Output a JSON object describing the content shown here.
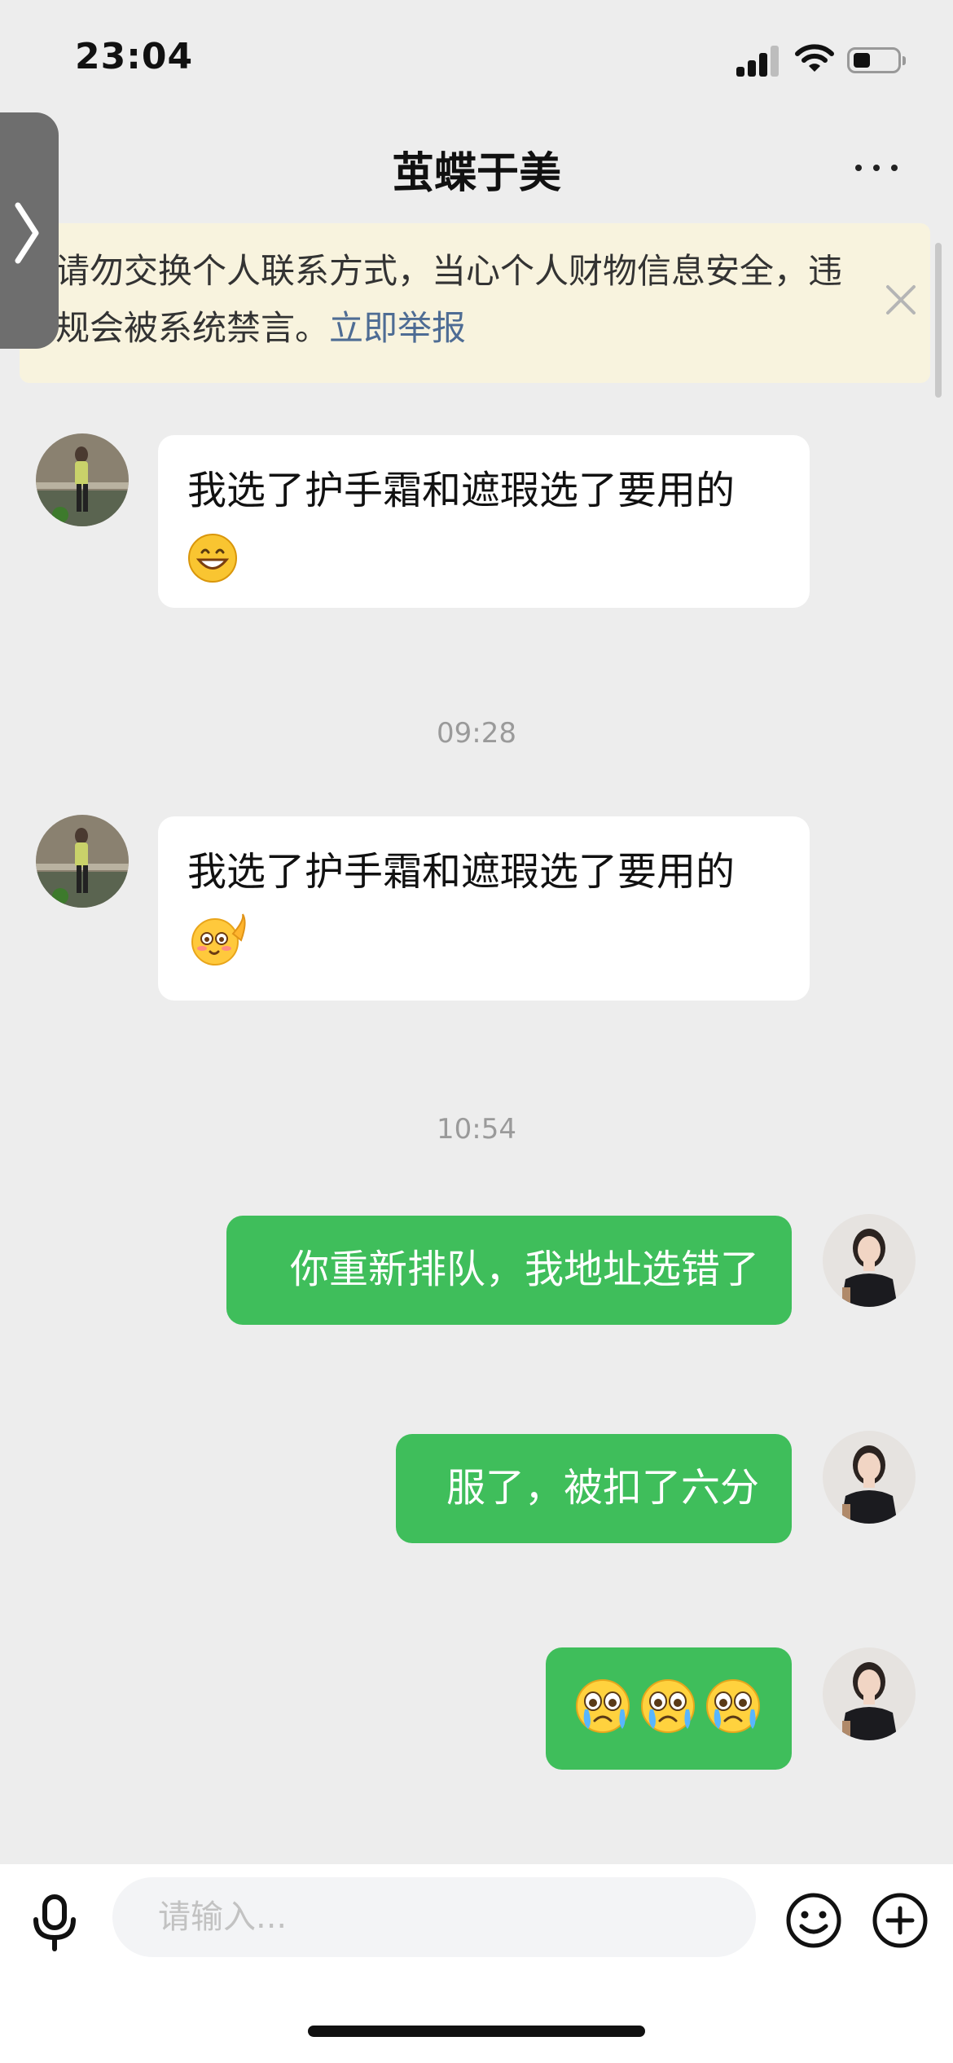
{
  "status_bar": {
    "time": "23:04"
  },
  "header": {
    "title": "茧蝶于美"
  },
  "notice": {
    "text": "请勿交换个人联系方式，当心个人财物信息安全，违规会被系统禁言。",
    "link": "立即举报"
  },
  "messages": [
    {
      "direction": "incoming",
      "text": "我选了护手霜和遮瑕选了要用的",
      "emoji": "grinning-face"
    },
    {
      "direction": "incoming",
      "text": "我选了护手霜和遮瑕选了要用的",
      "emoji": "waving-smile-face"
    },
    {
      "direction": "outgoing",
      "text": "你重新排队，我地址选错了"
    },
    {
      "direction": "outgoing",
      "text": "服了，被扣了六分"
    },
    {
      "direction": "outgoing",
      "text": "",
      "emoji": "crying-face ×3"
    }
  ],
  "timestamps": [
    "09:28",
    "10:54"
  ],
  "input": {
    "placeholder": "请输入..."
  },
  "icons": {
    "side_handle": "chevron-right-icon",
    "more": "more-dots-icon",
    "close": "close-icon",
    "mic": "microphone-icon",
    "emoji": "smiley-icon",
    "add": "plus-circle-icon"
  },
  "colors": {
    "background": "#ededed",
    "outgoing_bubble": "#3fbe5b",
    "incoming_bubble": "#ffffff",
    "notice_bg": "#f8f3de",
    "link": "#4e6c94"
  }
}
